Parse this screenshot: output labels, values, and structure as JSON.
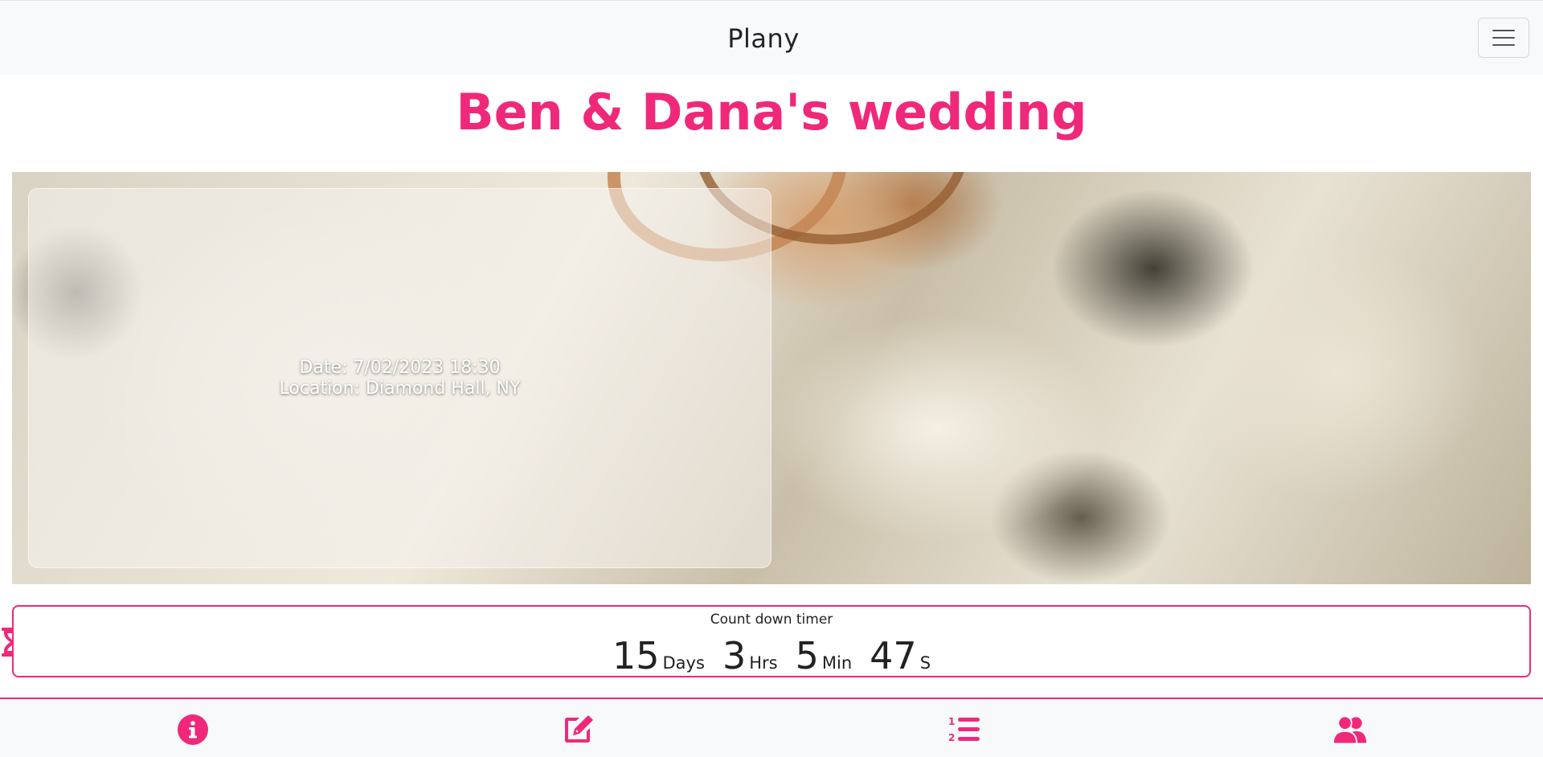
{
  "navbar": {
    "brand": "Plany",
    "menu_icon": "hamburger-menu-icon"
  },
  "event": {
    "title": "Ben & Dana's wedding",
    "date_line": "Date: 7/02/2023 18:30",
    "location_line": "Location: Diamond Hall, NY"
  },
  "countdown": {
    "label": "Count down timer",
    "icon": "hourglass-icon",
    "days": "15",
    "days_label": "Days",
    "hours": "3",
    "hours_label": "Hrs",
    "minutes": "5",
    "minutes_label": "Min",
    "seconds": "47",
    "seconds_label": "S"
  },
  "bottom_nav": {
    "items": [
      {
        "icon": "info-icon"
      },
      {
        "icon": "edit-icon"
      },
      {
        "icon": "numbered-list-icon"
      },
      {
        "icon": "users-icon"
      }
    ]
  },
  "colors": {
    "accent": "#f0287a",
    "navbar_bg": "#f8f9fa",
    "text": "#212529"
  }
}
